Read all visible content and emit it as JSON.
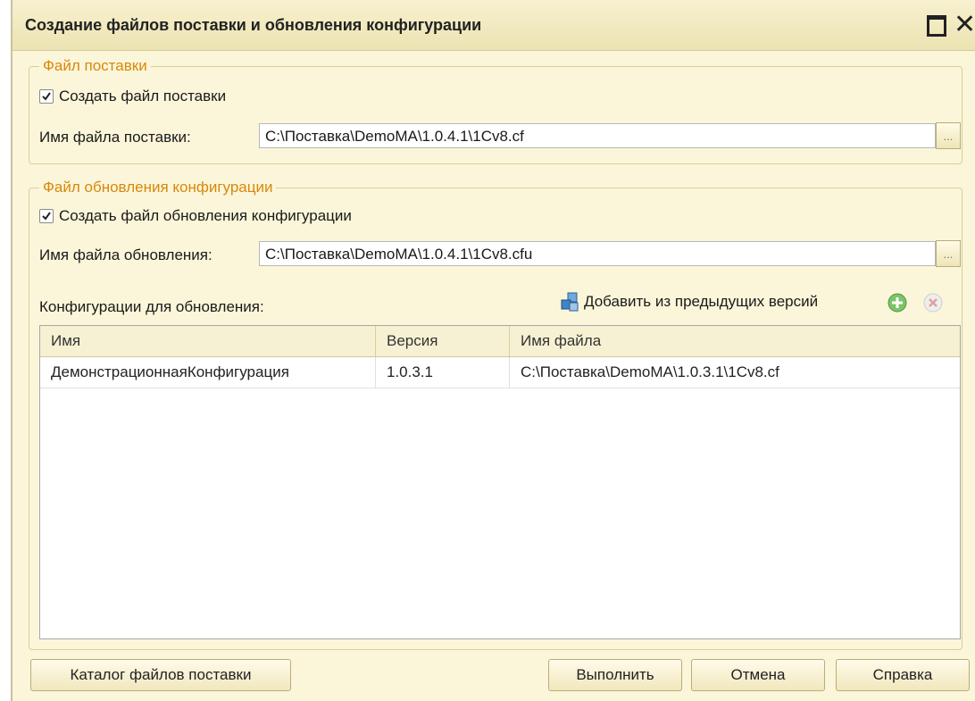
{
  "window": {
    "title": "Создание файлов поставки и обновления конфигурации"
  },
  "delivery": {
    "legend": "Файл поставки",
    "create_label": "Создать файл поставки",
    "create_checked": true,
    "file_label": "Имя файла поставки:",
    "file_value": "C:\\Поставка\\DemoMA\\1.0.4.1\\1Cv8.cf",
    "browse_label": "..."
  },
  "update": {
    "legend": "Файл обновления конфигурации",
    "create_label": "Создать файл обновления конфигурации",
    "create_checked": true,
    "file_label": "Имя файла обновления:",
    "file_value": "C:\\Поставка\\DemoMA\\1.0.4.1\\1Cv8.cfu",
    "browse_label": "...",
    "configs_label": "Конфигурации для обновления:",
    "add_prev_label": "Добавить из предыдущих версий"
  },
  "table": {
    "columns": [
      "Имя",
      "Версия",
      "Имя файла"
    ],
    "rows": [
      [
        "ДемонстрационнаяКонфигурация",
        "1.0.3.1",
        "C:\\Поставка\\DemoMA\\1.0.3.1\\1Cv8.cf"
      ]
    ]
  },
  "buttons": {
    "catalog": "Каталог файлов поставки",
    "execute": "Выполнить",
    "cancel": "Отмена",
    "help": "Справка"
  }
}
